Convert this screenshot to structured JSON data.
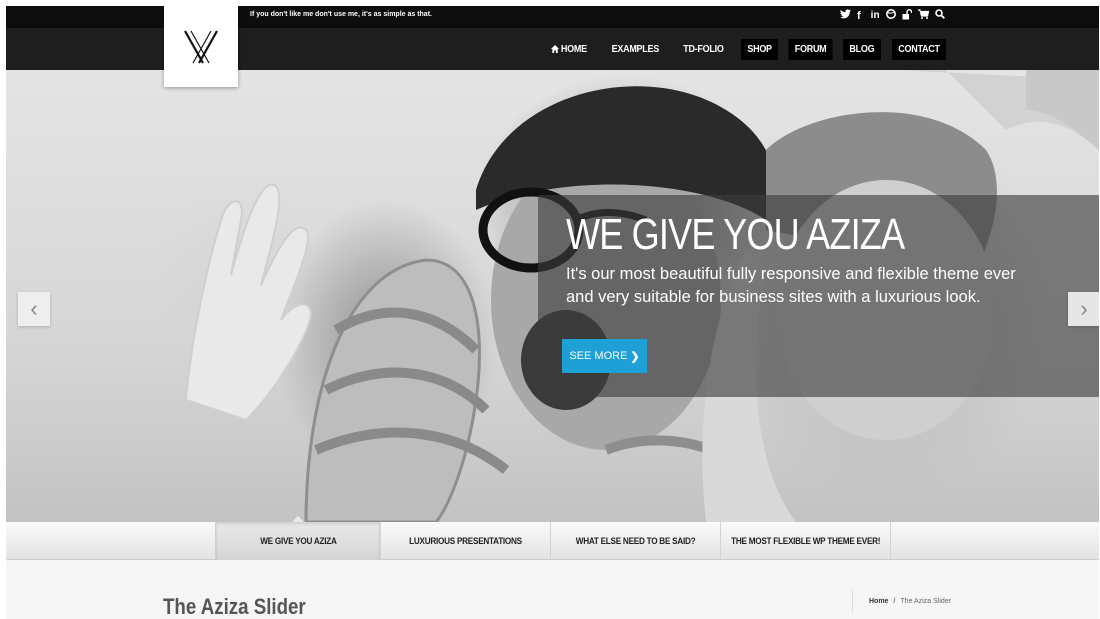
{
  "topbar": {
    "tagline": "If you don't like me don't use me, it's as simple as that.",
    "social_icons": [
      "twitter-icon",
      "facebook-icon",
      "linkedin-icon",
      "dribbble-icon",
      "lock-icon",
      "cart-icon",
      "search-icon"
    ],
    "social_glyphs": {
      "twitter": "🐦",
      "facebook": "f",
      "linkedin": "in",
      "dribbble": "◉",
      "lock": "🔓",
      "cart": "🛒",
      "search": "🔍"
    }
  },
  "nav": {
    "home_icon": "⌂",
    "items": [
      "HOME",
      "EXAMPLES",
      "TD-FOLIO",
      "SHOP",
      "FORUM",
      "BLOG",
      "CONTACT"
    ]
  },
  "hero": {
    "title": "WE GIVE YOU AZIZA",
    "subtitle": "It's our most beautiful fully responsive and flexible theme ever and very suitable for business sites with a luxurious look.",
    "cta_label": "SEE MORE",
    "cta_chevron": "❯",
    "prev_arrow": "‹",
    "next_arrow": "›"
  },
  "slide_tabs": [
    "WE GIVE YOU AZIZA",
    "LUXURIOUS PRESENTATIONS",
    "WHAT ELSE NEED TO BE SAID?",
    "THE MOST FLEXIBLE WP THEME EVER!"
  ],
  "page": {
    "title": "The Aziza Slider",
    "breadcrumb_home": "Home",
    "breadcrumb_sep": "/",
    "breadcrumb_current": "The Aziza Slider"
  },
  "colors": {
    "accent": "#1e9fd6",
    "topbar": "#0d0d0d",
    "navbar": "#1e1e1e"
  }
}
